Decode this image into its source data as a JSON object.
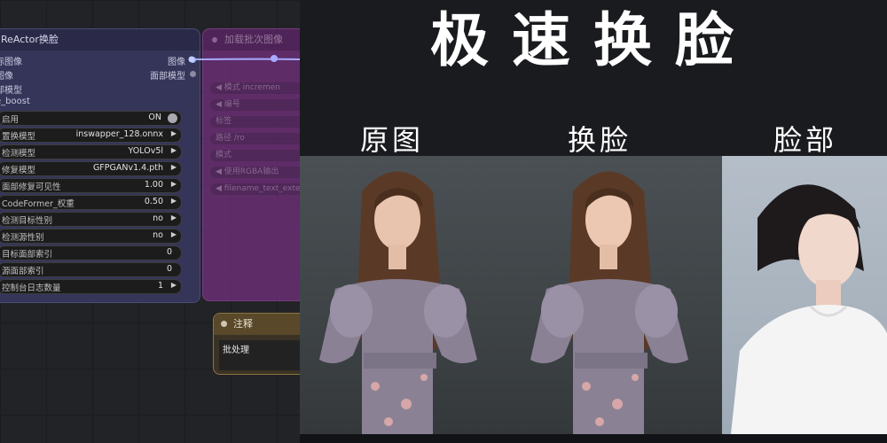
{
  "reactor_node": {
    "title": "ReActor换脸",
    "inputs": [
      "标图像",
      "图像",
      "部模型",
      "e_boost"
    ],
    "outputs": [
      "图像",
      "面部模型"
    ],
    "widgets": [
      {
        "label": "启用",
        "value": "ON"
      },
      {
        "label": "置换模型",
        "value": "inswapper_128.onnx"
      },
      {
        "label": "检测模型",
        "value": "YOLOv5l"
      },
      {
        "label": "修复模型",
        "value": "GFPGANv1.4.pth"
      },
      {
        "label": "面部修复可见性",
        "value": "1.00"
      },
      {
        "label": "CodeFormer_权重",
        "value": "0.50"
      },
      {
        "label": "检测目标性别",
        "value": "no"
      },
      {
        "label": "检测源性别",
        "value": "no"
      },
      {
        "label": "目标面部索引",
        "value": "0"
      },
      {
        "label": "源面部索引",
        "value": "0"
      },
      {
        "label": "控制台日志数量",
        "value": "1"
      }
    ]
  },
  "batch_node": {
    "title": "加载批次图像",
    "widgets": [
      "◀ 模式   incremen",
      "◀ 编号",
      "标签",
      "路径        /ro",
      "模式",
      "◀ 使用RGBA输出",
      "◀ filename_text_exter"
    ]
  },
  "note_node": {
    "title": "注释",
    "text": "批处理"
  },
  "panel": {
    "headline": "极速换脸",
    "captions": [
      "原图",
      "换脸",
      "脸部"
    ]
  },
  "colors": {
    "reactor_bg": "#35355a",
    "batch_bg": "#6f2f7a",
    "note_border": "#8e7540",
    "link": "#a9a9ff"
  }
}
